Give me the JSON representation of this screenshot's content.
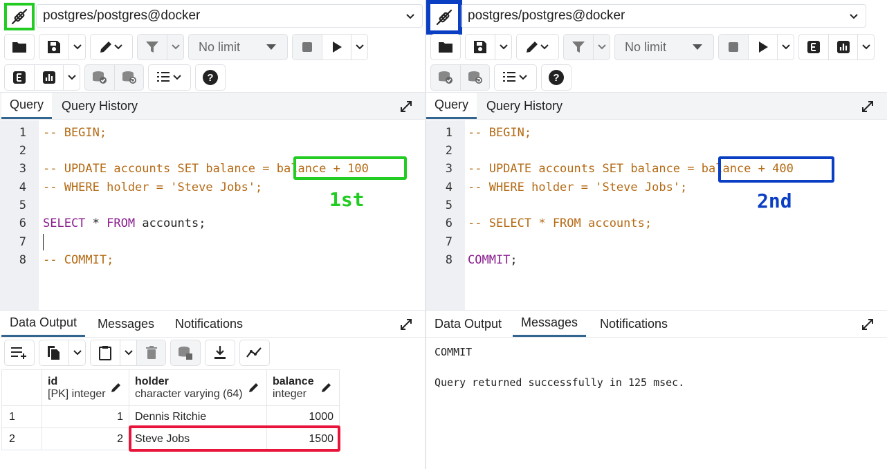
{
  "left": {
    "connection": "postgres/postgres@docker",
    "toolbar": {
      "limit": "No limit"
    },
    "tabs": {
      "query": "Query",
      "history": "Query History"
    },
    "editor": {
      "lines": [
        {
          "n": "1",
          "text": "-- BEGIN;"
        },
        {
          "n": "2",
          "text": ""
        },
        {
          "n": "3",
          "text": "-- UPDATE accounts SET balance = balance + 100"
        },
        {
          "n": "4",
          "text": "-- WHERE holder = 'Steve Jobs';"
        },
        {
          "n": "5",
          "text": ""
        },
        {
          "n": "6",
          "kw1": "SELECT",
          "t1": " * ",
          "kw2": "FROM",
          "t2": " accounts;"
        },
        {
          "n": "7",
          "text": ""
        },
        {
          "n": "8",
          "text": "-- COMMIT;"
        }
      ],
      "annotation": "1st"
    },
    "output_tabs": {
      "data": "Data Output",
      "messages": "Messages",
      "notifications": "Notifications"
    },
    "grid": {
      "columns": [
        {
          "name": "id",
          "type": "[PK] integer"
        },
        {
          "name": "holder",
          "type": "character varying (64)"
        },
        {
          "name": "balance",
          "type": "integer"
        }
      ],
      "rows": [
        {
          "rownum": "1",
          "id": "1",
          "holder": "Dennis Ritchie",
          "balance": "1000"
        },
        {
          "rownum": "2",
          "id": "2",
          "holder": "Steve Jobs",
          "balance": "1500"
        }
      ]
    }
  },
  "right": {
    "connection": "postgres/postgres@docker",
    "toolbar": {
      "limit": "No limit"
    },
    "tabs": {
      "query": "Query",
      "history": "Query History"
    },
    "editor": {
      "lines": [
        {
          "n": "1",
          "text": "-- BEGIN;"
        },
        {
          "n": "2",
          "text": ""
        },
        {
          "n": "3",
          "text": "-- UPDATE accounts SET balance = balance + 400"
        },
        {
          "n": "4",
          "text": "-- WHERE holder = 'Steve Jobs';"
        },
        {
          "n": "5",
          "text": ""
        },
        {
          "n": "6",
          "text": "-- SELECT * FROM accounts;"
        },
        {
          "n": "7",
          "text": ""
        },
        {
          "n": "8",
          "kw1": "COMMIT",
          "t1": ";"
        }
      ],
      "annotation": "2nd"
    },
    "output_tabs": {
      "data": "Data Output",
      "messages": "Messages",
      "notifications": "Notifications"
    },
    "messages": {
      "line1": "COMMIT",
      "line2": "Query returned successfully in 125 msec."
    }
  },
  "colors": {
    "highlight_green": "#22cc22",
    "highlight_blue": "#0a3fc4",
    "highlight_red": "#e8143a",
    "keyword": "#8a1c8e",
    "comment": "#b46a14",
    "tab_accent": "#326690"
  },
  "icons": [
    "plug-disconnect-icon",
    "folder-icon",
    "save-icon",
    "chevron-down-icon",
    "pencil-icon",
    "filter-icon",
    "stop-icon",
    "play-icon",
    "explain-icon",
    "explain-analyze-icon",
    "commit-icon",
    "rollback-icon",
    "macros-icon",
    "help-icon",
    "expand-icon",
    "add-row-icon",
    "copy-icon",
    "paste-icon",
    "delete-icon",
    "save-data-icon",
    "download-icon",
    "graph-icon"
  ]
}
